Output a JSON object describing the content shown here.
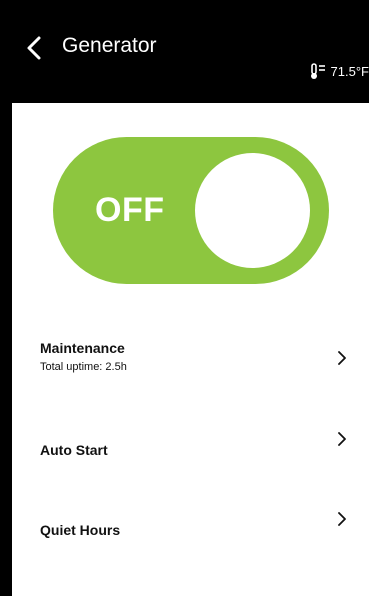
{
  "header": {
    "title": "Generator",
    "temperature": "71.5°F",
    "back_icon": "chevron-left-icon",
    "temp_icon": "thermometer-icon"
  },
  "power_toggle": {
    "state_label": "OFF",
    "is_on": false,
    "color": "#8dc63f"
  },
  "menu": {
    "maintenance": {
      "title": "Maintenance",
      "subtitle": "Total uptime: 2.5h"
    },
    "auto_start": {
      "title": "Auto Start"
    },
    "quiet_hours": {
      "title": "Quiet Hours"
    }
  }
}
